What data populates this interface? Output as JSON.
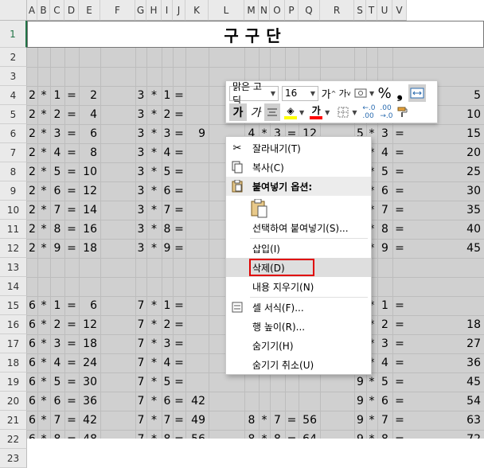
{
  "columns": [
    "A",
    "B",
    "C",
    "D",
    "E",
    "F",
    "G",
    "H",
    "I",
    "J",
    "K",
    "L",
    "M",
    "N",
    "O",
    "P",
    "Q",
    "R",
    "S",
    "T",
    "U",
    "V"
  ],
  "rows": [
    "1",
    "2",
    "3",
    "4",
    "5",
    "6",
    "7",
    "8",
    "9",
    "10",
    "11",
    "12",
    "13",
    "14",
    "15",
    "16",
    "17",
    "18",
    "19",
    "20",
    "21",
    "22",
    "23"
  ],
  "title": "구구단",
  "accent_color": "#217346",
  "table": {
    "block_2": [
      [
        "2",
        "*",
        "1",
        "=",
        "2"
      ],
      [
        "2",
        "*",
        "2",
        "=",
        "4"
      ],
      [
        "2",
        "*",
        "3",
        "=",
        "6"
      ],
      [
        "2",
        "*",
        "4",
        "=",
        "8"
      ],
      [
        "2",
        "*",
        "5",
        "=",
        "10"
      ],
      [
        "2",
        "*",
        "6",
        "=",
        "12"
      ],
      [
        "2",
        "*",
        "7",
        "=",
        "14"
      ],
      [
        "2",
        "*",
        "8",
        "=",
        "16"
      ],
      [
        "2",
        "*",
        "9",
        "=",
        "18"
      ]
    ],
    "block_3": [
      [
        "3",
        "*",
        "1",
        "="
      ],
      [
        "3",
        "*",
        "2",
        "="
      ],
      [
        "3",
        "*",
        "3",
        "=",
        "9"
      ],
      [
        "3",
        "*",
        "4",
        "="
      ],
      [
        "3",
        "*",
        "5",
        "="
      ],
      [
        "3",
        "*",
        "6",
        "="
      ],
      [
        "3",
        "*",
        "7",
        "="
      ],
      [
        "3",
        "*",
        "8",
        "="
      ],
      [
        "3",
        "*",
        "9",
        "="
      ]
    ],
    "block_4_partial": [
      [
        "4",
        "*",
        "3",
        "=",
        "12"
      ]
    ],
    "block_5": [
      [
        "5",
        "=",
        "5"
      ],
      [
        "2",
        "=",
        "10"
      ],
      [
        "5",
        "*",
        "3",
        "=",
        "15"
      ],
      [
        "5",
        "*",
        "4",
        "=",
        "20"
      ],
      [
        "5",
        "*",
        "5",
        "=",
        "25"
      ],
      [
        "5",
        "*",
        "6",
        "=",
        "30"
      ],
      [
        "5",
        "*",
        "7",
        "=",
        "35"
      ],
      [
        "5",
        "*",
        "8",
        "=",
        "40"
      ],
      [
        "5",
        "*",
        "9",
        "=",
        "45"
      ]
    ],
    "block_6": [
      [
        "6",
        "*",
        "1",
        "=",
        "6"
      ],
      [
        "6",
        "*",
        "2",
        "=",
        "12"
      ],
      [
        "6",
        "*",
        "3",
        "=",
        "18"
      ],
      [
        "6",
        "*",
        "4",
        "=",
        "24"
      ],
      [
        "6",
        "*",
        "5",
        "=",
        "30"
      ],
      [
        "6",
        "*",
        "6",
        "=",
        "36"
      ],
      [
        "6",
        "*",
        "7",
        "=",
        "42"
      ],
      [
        "6",
        "*",
        "8",
        "=",
        "48"
      ],
      [
        "6",
        "*",
        "9",
        "=",
        "54"
      ]
    ],
    "block_7": [
      [
        "7",
        "*",
        "1",
        "="
      ],
      [
        "7",
        "*",
        "2",
        "="
      ],
      [
        "7",
        "*",
        "3",
        "="
      ],
      [
        "7",
        "*",
        "4",
        "="
      ],
      [
        "7",
        "*",
        "5",
        "="
      ],
      [
        "7",
        "*",
        "6",
        "=",
        "42"
      ],
      [
        "7",
        "*",
        "7",
        "=",
        "49"
      ],
      [
        "7",
        "*",
        "8",
        "=",
        "56"
      ],
      [
        "7",
        "*",
        "9",
        "=",
        "63"
      ]
    ],
    "block_8": [
      [
        "8",
        "*",
        "7",
        "=",
        "56"
      ],
      [
        "8",
        "*",
        "8",
        "=",
        "64"
      ],
      [
        "8",
        "*",
        "9",
        "=",
        "72"
      ]
    ],
    "block_9": [
      [
        "9",
        "*",
        "1",
        "="
      ],
      [
        "9",
        "*",
        "2",
        "=",
        "18"
      ],
      [
        "9",
        "*",
        "3",
        "=",
        "27"
      ],
      [
        "9",
        "*",
        "4",
        "=",
        "36"
      ],
      [
        "9",
        "*",
        "5",
        "=",
        "45"
      ],
      [
        "9",
        "*",
        "6",
        "=",
        "54"
      ],
      [
        "9",
        "*",
        "7",
        "=",
        "63"
      ],
      [
        "9",
        "*",
        "8",
        "=",
        "72"
      ],
      [
        "9",
        "*",
        "9",
        "=",
        "81"
      ]
    ]
  },
  "mini_toolbar": {
    "font_name": "맑은 고딕",
    "font_size": "16",
    "grow_font": "가",
    "shrink_font": "가",
    "percent": "%",
    "comma": "❟",
    "bold": "가",
    "italic": "가",
    "font_color_glyph": "가",
    "fill_color": "#ffff00",
    "font_color": "#ff0000"
  },
  "context_menu": {
    "cut": "잘라내기(T)",
    "copy": "복사(C)",
    "paste_options": "붙여넣기 옵션:",
    "paste_special": "선택하여 붙여넣기(S)...",
    "insert": "삽입(I)",
    "delete": "삭제(D)",
    "clear_contents": "내용 지우기(N)",
    "format_cells": "셀 서식(F)...",
    "row_height": "행 높이(R)...",
    "hide": "숨기기(H)",
    "unhide": "숨기기 취소(U)"
  }
}
